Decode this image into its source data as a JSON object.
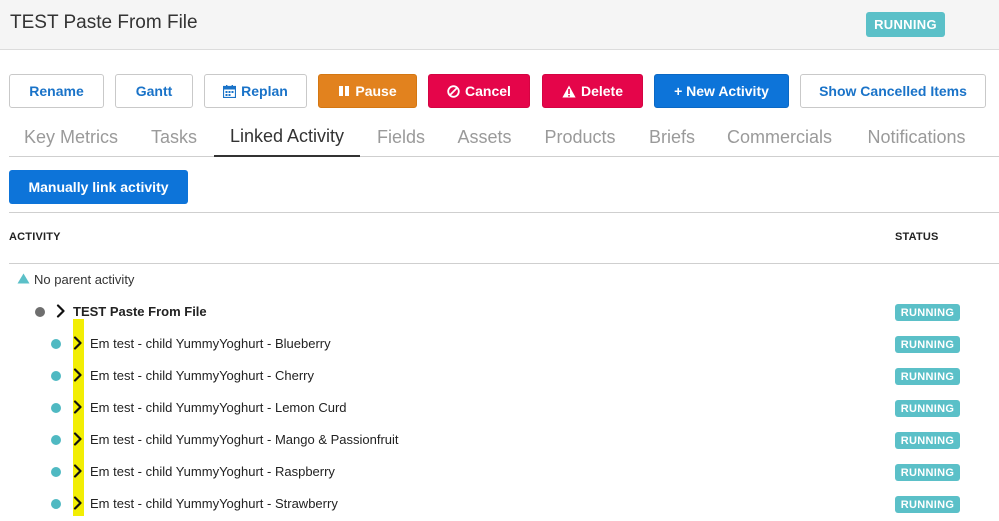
{
  "header": {
    "title": "TEST Paste From File",
    "status": "RUNNING"
  },
  "toolbar": {
    "rename": "Rename",
    "gantt": "Gantt",
    "replan": "Replan",
    "pause": "Pause",
    "cancel": "Cancel",
    "delete": "Delete",
    "new_activity": "+ New Activity",
    "show_cancelled": "Show Cancelled Items"
  },
  "tabs": [
    "Key Metrics",
    "Tasks",
    "Linked Activity",
    "Fields",
    "Assets",
    "Products",
    "Briefs",
    "Commercials",
    "Notifications"
  ],
  "active_tab": "Linked Activity",
  "linked": {
    "manual_link_label": "Manually link activity",
    "col_activity": "ACTIVITY",
    "col_status": "STATUS",
    "no_parent": "No parent activity",
    "parent": {
      "name": "TEST Paste From File",
      "status": "RUNNING"
    },
    "children": [
      {
        "name": "Em test - child YummyYoghurt - Blueberry",
        "status": "RUNNING"
      },
      {
        "name": "Em test - child YummyYoghurt - Cherry",
        "status": "RUNNING"
      },
      {
        "name": "Em test - child YummyYoghurt - Lemon Curd",
        "status": "RUNNING"
      },
      {
        "name": "Em test - child YummyYoghurt - Mango & Passionfruit",
        "status": "RUNNING"
      },
      {
        "name": "Em test - child YummyYoghurt - Raspberry",
        "status": "RUNNING"
      },
      {
        "name": "Em test - child YummyYoghurt - Strawberry",
        "status": "RUNNING"
      }
    ]
  },
  "colors": {
    "accent_blue": "#0d74d9",
    "pause_orange": "#e2821e",
    "danger_red": "#e5054a",
    "status_teal": "#5bc0c8",
    "highlight_yellow": "#f2ee04"
  },
  "icons": {
    "replan": "calendar-icon",
    "pause": "pause-icon",
    "cancel": "ban-icon",
    "delete": "warning-icon",
    "no_parent": "triangle-up-icon",
    "expand": "chevron-right-icon"
  }
}
